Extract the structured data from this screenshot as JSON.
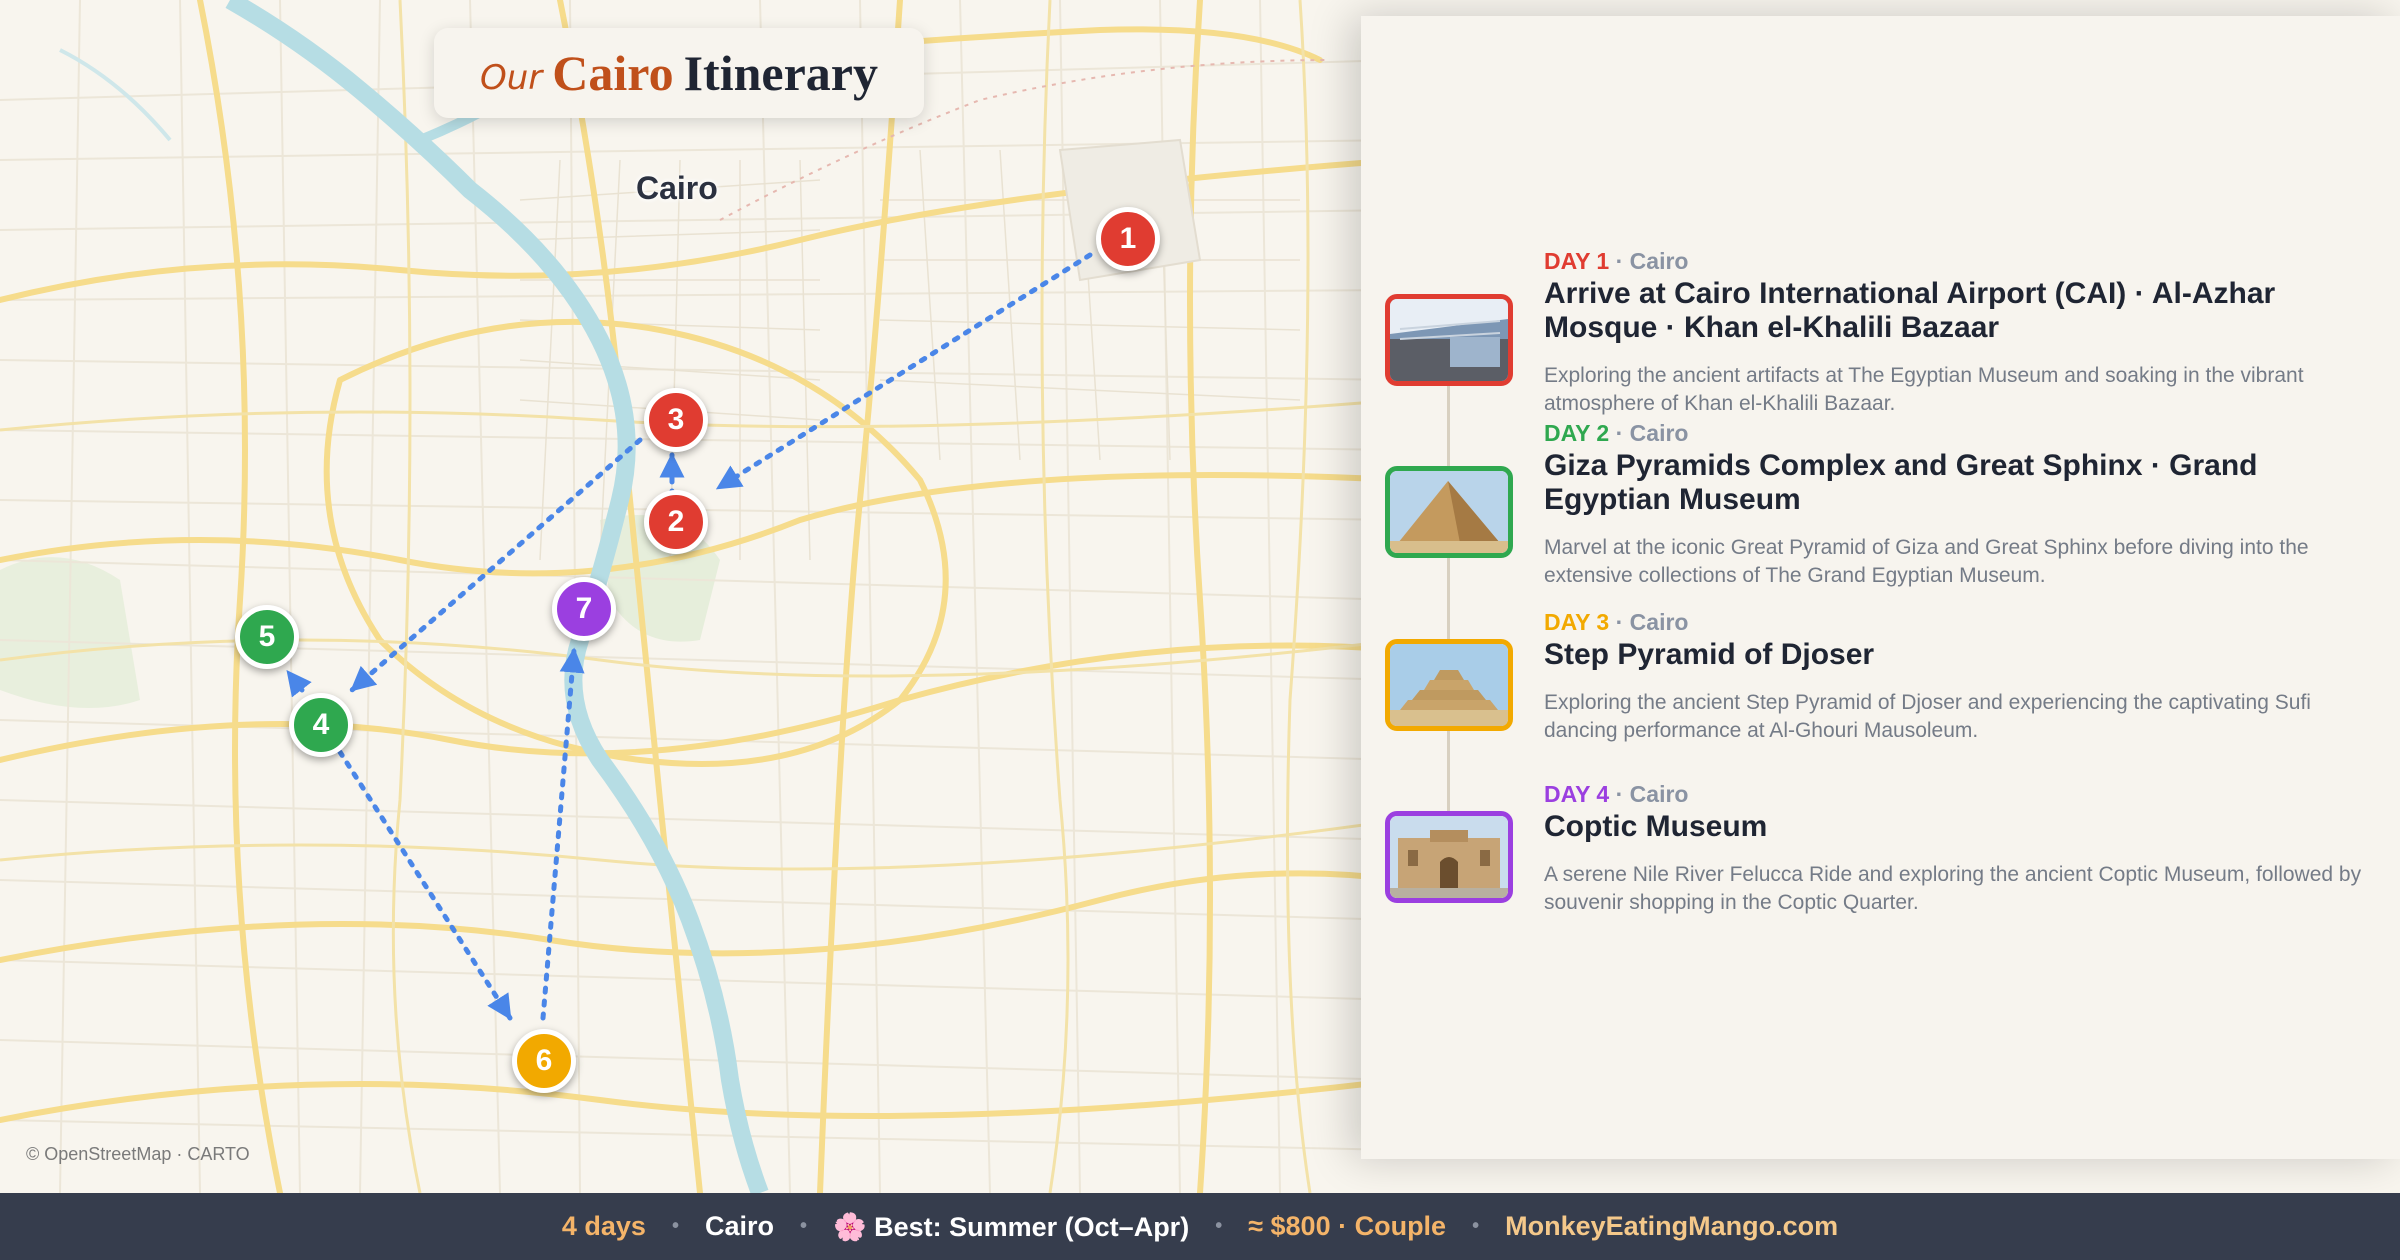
{
  "map": {
    "title_prefix": "Our",
    "title_city": "Cairo",
    "title_suffix": "Itinerary",
    "city_label": "Cairo",
    "attribution": "© OpenStreetMap · CARTO",
    "markers": [
      {
        "label": "1",
        "color": "#e03c31"
      },
      {
        "label": "2",
        "color": "#e03c31"
      },
      {
        "label": "3",
        "color": "#e03c31"
      },
      {
        "label": "4",
        "color": "#2fa84f"
      },
      {
        "label": "5",
        "color": "#2fa84f"
      },
      {
        "label": "6",
        "color": "#f2a900"
      },
      {
        "label": "7",
        "color": "#9b3fe0"
      }
    ],
    "route_color": "#4a86e8"
  },
  "days": [
    {
      "day": "DAY 1",
      "city": "Cairo",
      "color": "#e03c31",
      "title": "Arrive at Cairo International Airport (CAI) · Al-Azhar Mosque · Khan el-Khalili Bazaar",
      "desc": "Exploring the ancient artifacts at The Egyptian Museum and soaking in the vibrant atmosphere of Khan el-Khalili Bazaar."
    },
    {
      "day": "DAY 2",
      "city": "Cairo",
      "color": "#2fa84f",
      "title": "Giza Pyramids Complex and Great Sphinx · Grand Egyptian Museum",
      "desc": "Marvel at the iconic Great Pyramid of Giza and Great Sphinx before diving into the extensive collections of The Grand Egyptian Museum."
    },
    {
      "day": "DAY 3",
      "city": "Cairo",
      "color": "#f2a900",
      "title": "Step Pyramid of Djoser",
      "desc": "Exploring the ancient Step Pyramid of Djoser and experiencing the captivating Sufi dancing performance at Al-Ghouri Mausoleum."
    },
    {
      "day": "DAY 4",
      "city": "Cairo",
      "color": "#9b3fe0",
      "title": "Coptic Museum",
      "desc": "A serene Nile River Felucca Ride and exploring the ancient Coptic Museum, followed by souvenir shopping in the Coptic Quarter."
    }
  ],
  "footer": {
    "duration": "4 days",
    "city": "Cairo",
    "best": "🌸 Best: Summer (Oct–Apr)",
    "budget": "≈ $800 · Couple",
    "site": "MonkeyEatingMango.com"
  }
}
